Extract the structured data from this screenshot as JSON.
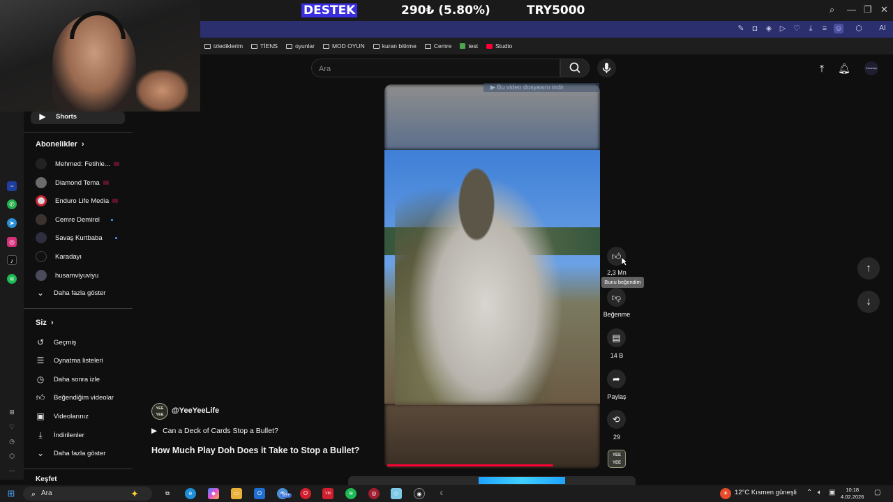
{
  "overlay": {
    "support_label": "DESTEK",
    "amount": "290₺ (5.80%)",
    "target": "TRY5000"
  },
  "bookmarks": [
    {
      "label": "izlediklerim",
      "icon": "folder-icon"
    },
    {
      "label": "TİENS",
      "icon": "folder-icon"
    },
    {
      "label": "oyunlar",
      "icon": "folder-icon"
    },
    {
      "label": "MOD OYUN",
      "icon": "folder-icon"
    },
    {
      "label": "kuran bitirme",
      "icon": "folder-icon"
    },
    {
      "label": "Cemre",
      "icon": "folder-icon"
    },
    {
      "label": "test",
      "icon": "sheet-icon"
    },
    {
      "label": "Studio",
      "icon": "youtube-icon"
    }
  ],
  "browser": {
    "ai_label": "AI"
  },
  "search": {
    "placeholder": "Ara"
  },
  "sidebar": {
    "shorts_label": "Shorts",
    "subscriptions_title": "Abonelikler",
    "subscriptions": [
      {
        "name": "Mehmed: Fetihle...",
        "status": "live"
      },
      {
        "name": "Diamond Tema",
        "status": "live"
      },
      {
        "name": "Enduro Life Media",
        "status": "live"
      },
      {
        "name": "Cemre Demirel",
        "status": "new"
      },
      {
        "name": "Savaş Kurtbaba",
        "status": "new"
      },
      {
        "name": "Karadayı",
        "status": ""
      },
      {
        "name": "husamviyuviyu",
        "status": ""
      }
    ],
    "subs_more": "Daha fazla göster",
    "you_title": "Siz",
    "you_items": [
      {
        "label": "Geçmiş",
        "icon": "history-icon"
      },
      {
        "label": "Oynatma listeleri",
        "icon": "playlist-icon"
      },
      {
        "label": "Daha sonra izle",
        "icon": "clock-icon"
      },
      {
        "label": "Beğendiğim videolar",
        "icon": "thumbs-up-icon"
      },
      {
        "label": "Videolarınız",
        "icon": "play-square-icon"
      },
      {
        "label": "İndirilenler",
        "icon": "download-icon"
      }
    ],
    "you_more": "Daha fazla göster",
    "explore_title": "Keşfet"
  },
  "video": {
    "download_banner": "Bu video dosyasını indir",
    "progress": 0.79,
    "channel": "@YeeYeeLife",
    "channel_avatar_text": "YEE YEE",
    "related": "Can a Deck of Cards Stop a Bullet?",
    "title": "How Much Play Doh Does it Take to Stop a Bullet?"
  },
  "actions": {
    "likes": "2,3 Mn",
    "like_tooltip": "Bunu beğendim",
    "dislike_label": "Beğenme",
    "comments": "14 B",
    "share_label": "Paylaş",
    "remix_count": "29"
  },
  "header": {
    "avatar_label": "Karadayı"
  },
  "taskbar": {
    "search_placeholder": "Ara",
    "badge": "99+",
    "weather": "12°C  Kısmen güneşli",
    "time": "10:18",
    "date": "4.02.2026"
  }
}
